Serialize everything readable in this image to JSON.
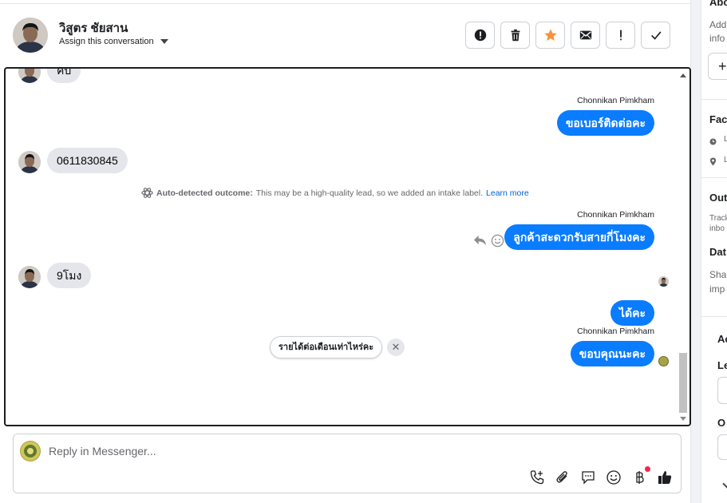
{
  "header": {
    "contact_name": "วิสูตร ชัยสาน",
    "assign_label": "Assign this conversation"
  },
  "actions": [
    {
      "name": "spam-button",
      "icon": "alert-circle-icon"
    },
    {
      "name": "delete-button",
      "icon": "trash-icon"
    },
    {
      "name": "star-button",
      "icon": "star-icon",
      "color": "#f7923b"
    },
    {
      "name": "mark-unread-button",
      "icon": "envelope-icon"
    },
    {
      "name": "follow-up-button",
      "icon": "exclamation-icon"
    },
    {
      "name": "mark-done-button",
      "icon": "check-icon"
    }
  ],
  "messages": {
    "m0": "คับ",
    "m1_sender": "Chonnikan Pimkham",
    "m1": "ขอเบอร์ติดต่อคะ",
    "m2": "0611830845",
    "outcome_title": "Auto-detected outcome:",
    "outcome_text": "This may be a high-quality lead, so we added an intake label.",
    "outcome_link": "Learn more",
    "m3_sender": "Chonnikan Pimkham",
    "m3": "ลูกค้าสะดวกรับสายกี่โมงคะ",
    "m4": "9โมง",
    "m5": "ได้คะ",
    "m6_sender": "Chonnikan Pimkham",
    "m6": "ขอบคุณนะคะ"
  },
  "suggestion": {
    "text": "รายได้ต่อเดือนเท่าไหร่คะ",
    "close": "✕"
  },
  "composer": {
    "placeholder": "Reply in Messenger..."
  },
  "panel": {
    "about": "Abo",
    "add_text_1": "Add",
    "add_text_2": "info",
    "add_btn": "+",
    "fac": "Fac",
    "l1": "L",
    "l2": "L",
    "out": "Out",
    "track1": "Track",
    "track2": "inbo",
    "dat": "Dat",
    "share1": "Shar",
    "share2": "imp",
    "ac": "Ac",
    "le": "Le",
    "o": "O"
  },
  "colors": {
    "accent": "#0a7cff",
    "star": "#f7923b"
  }
}
